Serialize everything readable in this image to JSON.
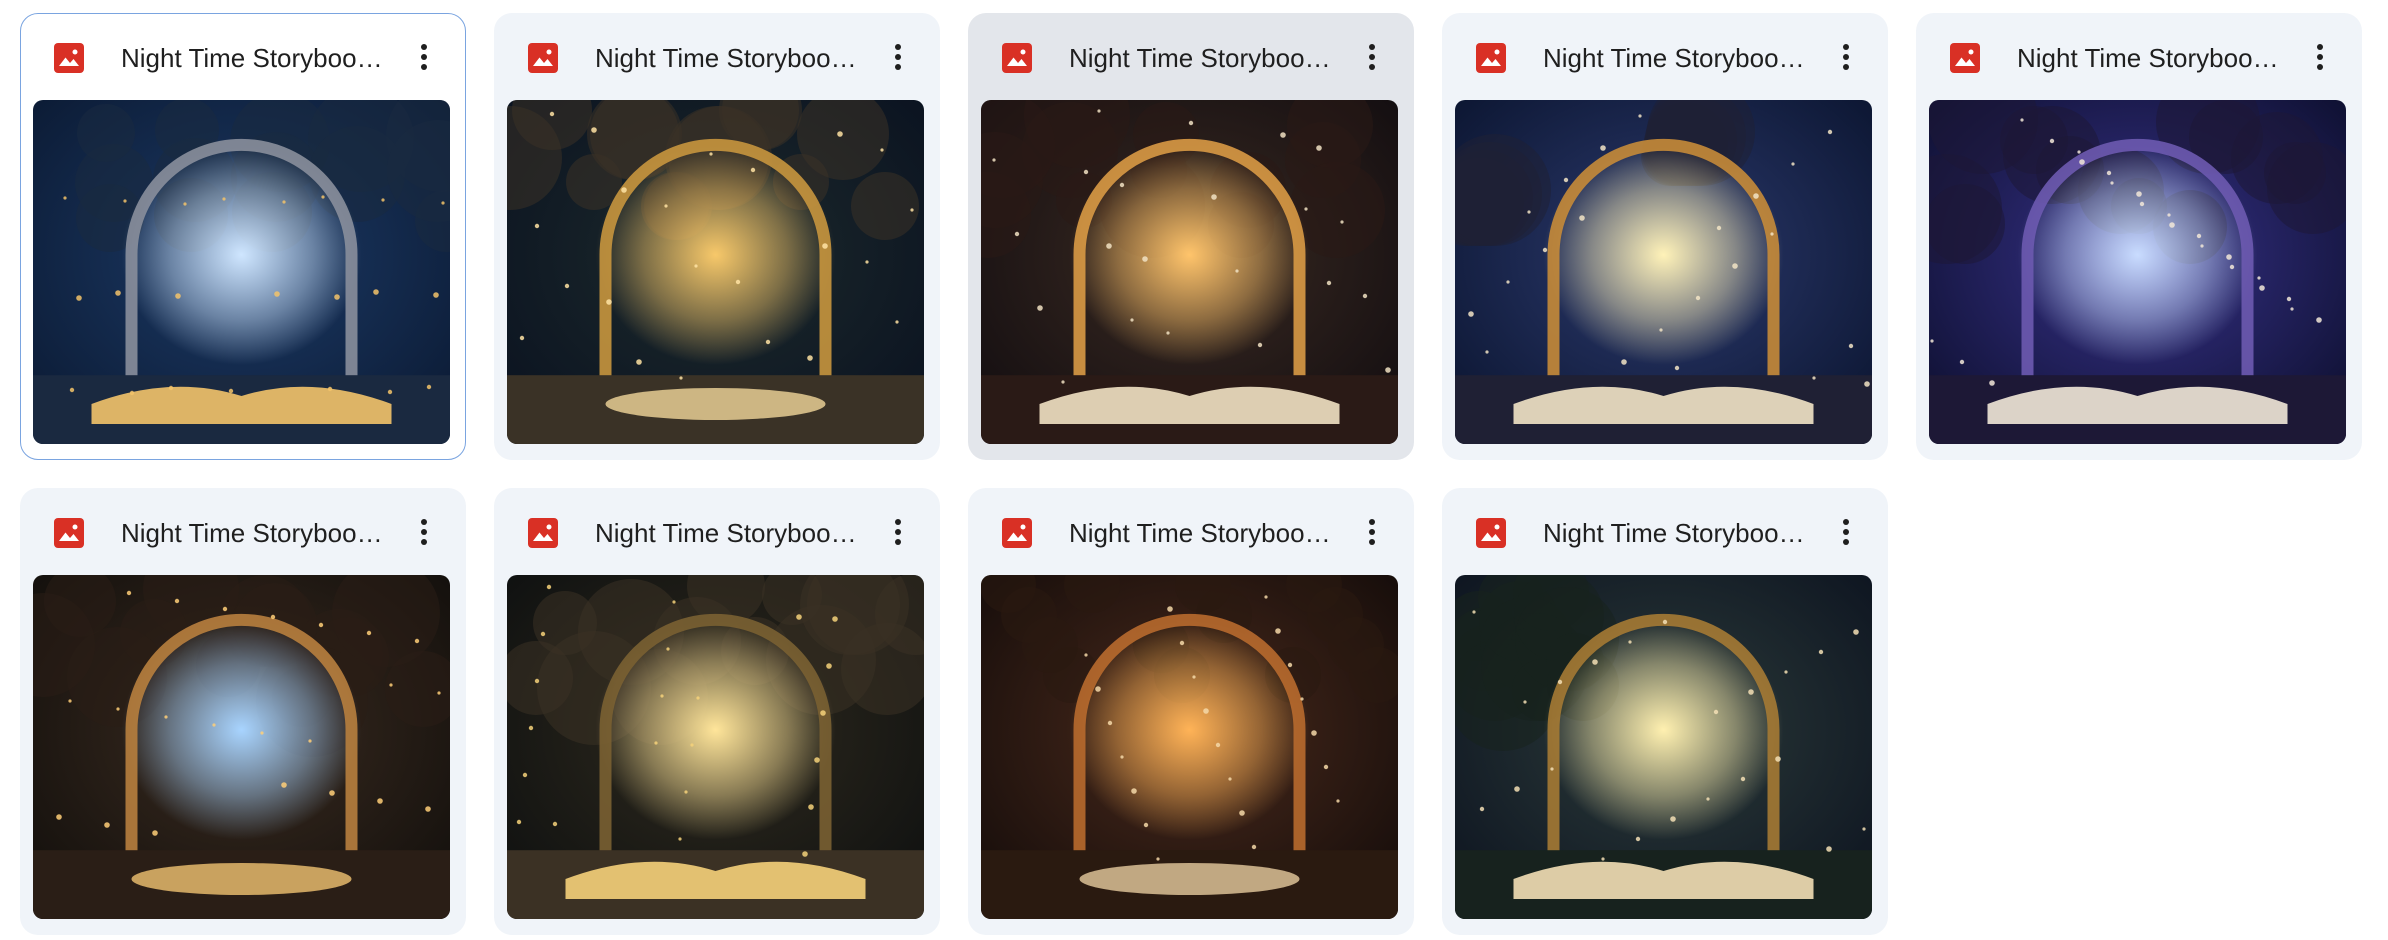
{
  "files": [
    {
      "name": "Night Time Storybook Backdrops",
      "icon": "image-file-icon",
      "state": "selected",
      "palette": {
        "sky": "#0b1a33",
        "mid": "#1c3a66",
        "glow": "#cfe6ff",
        "arch": "#8a8f9c",
        "ground": "#1a2940",
        "accent": "#f3c36a"
      }
    },
    {
      "name": "Night Time Storybook Backdrops",
      "icon": "image-file-icon",
      "state": "normal",
      "palette": {
        "sky": "#0a1220",
        "mid": "#1d2a2c",
        "glow": "#f7c86a",
        "arch": "#c8963e",
        "ground": "#3a3226",
        "accent": "#ffe3a3"
      }
    },
    {
      "name": "Night Time Storybook Backdrops",
      "icon": "image-file-icon",
      "state": "hovered",
      "palette": {
        "sky": "#120d10",
        "mid": "#3a2a22",
        "glow": "#ffc46b",
        "arch": "#d99a45",
        "ground": "#2a1a16",
        "accent": "#f1e2c3"
      }
    },
    {
      "name": "Night Time Storybook Backdrops",
      "icon": "image-file-icon",
      "state": "normal",
      "palette": {
        "sky": "#0b1530",
        "mid": "#2c3a6e",
        "glow": "#fff2b8",
        "arch": "#c78b38",
        "ground": "#1f2034",
        "accent": "#f2e4c6"
      }
    },
    {
      "name": "Night Time Storybook Backdrops",
      "icon": "image-file-icon",
      "state": "normal",
      "palette": {
        "sky": "#0d0f2e",
        "mid": "#37328a",
        "glow": "#c9dcff",
        "arch": "#6d5ab0",
        "ground": "#1d1836",
        "accent": "#f2e8d8"
      }
    },
    {
      "name": "Night Time Storybook Backdrops",
      "icon": "image-file-icon",
      "state": "normal",
      "palette": {
        "sky": "#120f0c",
        "mid": "#3a2b20",
        "glow": "#a8d4ff",
        "arch": "#b8803e",
        "ground": "#2a1e16",
        "accent": "#ffcf78"
      }
    },
    {
      "name": "Night Time Storybook Backdrops",
      "icon": "image-file-icon",
      "state": "normal",
      "palette": {
        "sky": "#0e1010",
        "mid": "#2f2a1e",
        "glow": "#ffe59a",
        "arch": "#7a6032",
        "ground": "#3b3124",
        "accent": "#f6d27a"
      }
    },
    {
      "name": "Night Time Storybook Backdrops",
      "icon": "image-file-icon",
      "state": "normal",
      "palette": {
        "sky": "#140c0a",
        "mid": "#4a2a1c",
        "glow": "#ffb357",
        "arch": "#b86a2e",
        "ground": "#2a1a10",
        "accent": "#f4d8a8"
      }
    },
    {
      "name": "Night Time Storybook Backdrops",
      "icon": "image-file-icon",
      "state": "normal",
      "palette": {
        "sky": "#0d1420",
        "mid": "#2c3b3a",
        "glow": "#fff0b0",
        "arch": "#a57a34",
        "ground": "#17221e",
        "accent": "#f3dfb5"
      }
    }
  ],
  "menu_icon": "more-vert-icon",
  "colors": {
    "card_bg": "#f0f4f9",
    "card_selected_border": "#7aa4e0",
    "card_hover_bg": "#e3e6eb",
    "image_icon_red": "#d93025",
    "text": "#1f1f1f"
  }
}
